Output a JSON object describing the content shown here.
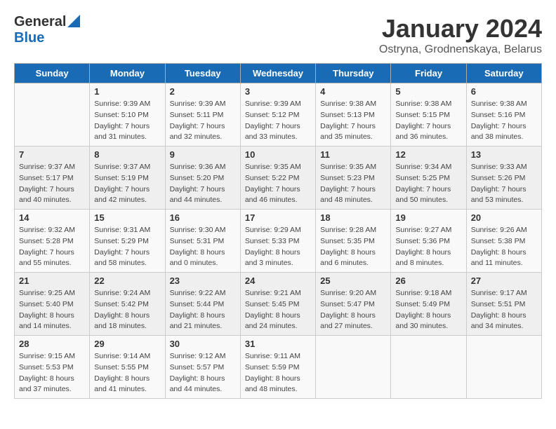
{
  "logo": {
    "general": "General",
    "blue": "Blue"
  },
  "title": "January 2024",
  "subtitle": "Ostryna, Grodnenskaya, Belarus",
  "days_of_week": [
    "Sunday",
    "Monday",
    "Tuesday",
    "Wednesday",
    "Thursday",
    "Friday",
    "Saturday"
  ],
  "weeks": [
    [
      {
        "day": "",
        "info": ""
      },
      {
        "day": "1",
        "info": "Sunrise: 9:39 AM\nSunset: 5:10 PM\nDaylight: 7 hours\nand 31 minutes."
      },
      {
        "day": "2",
        "info": "Sunrise: 9:39 AM\nSunset: 5:11 PM\nDaylight: 7 hours\nand 32 minutes."
      },
      {
        "day": "3",
        "info": "Sunrise: 9:39 AM\nSunset: 5:12 PM\nDaylight: 7 hours\nand 33 minutes."
      },
      {
        "day": "4",
        "info": "Sunrise: 9:38 AM\nSunset: 5:13 PM\nDaylight: 7 hours\nand 35 minutes."
      },
      {
        "day": "5",
        "info": "Sunrise: 9:38 AM\nSunset: 5:15 PM\nDaylight: 7 hours\nand 36 minutes."
      },
      {
        "day": "6",
        "info": "Sunrise: 9:38 AM\nSunset: 5:16 PM\nDaylight: 7 hours\nand 38 minutes."
      }
    ],
    [
      {
        "day": "7",
        "info": "Sunrise: 9:37 AM\nSunset: 5:17 PM\nDaylight: 7 hours\nand 40 minutes."
      },
      {
        "day": "8",
        "info": "Sunrise: 9:37 AM\nSunset: 5:19 PM\nDaylight: 7 hours\nand 42 minutes."
      },
      {
        "day": "9",
        "info": "Sunrise: 9:36 AM\nSunset: 5:20 PM\nDaylight: 7 hours\nand 44 minutes."
      },
      {
        "day": "10",
        "info": "Sunrise: 9:35 AM\nSunset: 5:22 PM\nDaylight: 7 hours\nand 46 minutes."
      },
      {
        "day": "11",
        "info": "Sunrise: 9:35 AM\nSunset: 5:23 PM\nDaylight: 7 hours\nand 48 minutes."
      },
      {
        "day": "12",
        "info": "Sunrise: 9:34 AM\nSunset: 5:25 PM\nDaylight: 7 hours\nand 50 minutes."
      },
      {
        "day": "13",
        "info": "Sunrise: 9:33 AM\nSunset: 5:26 PM\nDaylight: 7 hours\nand 53 minutes."
      }
    ],
    [
      {
        "day": "14",
        "info": "Sunrise: 9:32 AM\nSunset: 5:28 PM\nDaylight: 7 hours\nand 55 minutes."
      },
      {
        "day": "15",
        "info": "Sunrise: 9:31 AM\nSunset: 5:29 PM\nDaylight: 7 hours\nand 58 minutes."
      },
      {
        "day": "16",
        "info": "Sunrise: 9:30 AM\nSunset: 5:31 PM\nDaylight: 8 hours\nand 0 minutes."
      },
      {
        "day": "17",
        "info": "Sunrise: 9:29 AM\nSunset: 5:33 PM\nDaylight: 8 hours\nand 3 minutes."
      },
      {
        "day": "18",
        "info": "Sunrise: 9:28 AM\nSunset: 5:35 PM\nDaylight: 8 hours\nand 6 minutes."
      },
      {
        "day": "19",
        "info": "Sunrise: 9:27 AM\nSunset: 5:36 PM\nDaylight: 8 hours\nand 8 minutes."
      },
      {
        "day": "20",
        "info": "Sunrise: 9:26 AM\nSunset: 5:38 PM\nDaylight: 8 hours\nand 11 minutes."
      }
    ],
    [
      {
        "day": "21",
        "info": "Sunrise: 9:25 AM\nSunset: 5:40 PM\nDaylight: 8 hours\nand 14 minutes."
      },
      {
        "day": "22",
        "info": "Sunrise: 9:24 AM\nSunset: 5:42 PM\nDaylight: 8 hours\nand 18 minutes."
      },
      {
        "day": "23",
        "info": "Sunrise: 9:22 AM\nSunset: 5:44 PM\nDaylight: 8 hours\nand 21 minutes."
      },
      {
        "day": "24",
        "info": "Sunrise: 9:21 AM\nSunset: 5:45 PM\nDaylight: 8 hours\nand 24 minutes."
      },
      {
        "day": "25",
        "info": "Sunrise: 9:20 AM\nSunset: 5:47 PM\nDaylight: 8 hours\nand 27 minutes."
      },
      {
        "day": "26",
        "info": "Sunrise: 9:18 AM\nSunset: 5:49 PM\nDaylight: 8 hours\nand 30 minutes."
      },
      {
        "day": "27",
        "info": "Sunrise: 9:17 AM\nSunset: 5:51 PM\nDaylight: 8 hours\nand 34 minutes."
      }
    ],
    [
      {
        "day": "28",
        "info": "Sunrise: 9:15 AM\nSunset: 5:53 PM\nDaylight: 8 hours\nand 37 minutes."
      },
      {
        "day": "29",
        "info": "Sunrise: 9:14 AM\nSunset: 5:55 PM\nDaylight: 8 hours\nand 41 minutes."
      },
      {
        "day": "30",
        "info": "Sunrise: 9:12 AM\nSunset: 5:57 PM\nDaylight: 8 hours\nand 44 minutes."
      },
      {
        "day": "31",
        "info": "Sunrise: 9:11 AM\nSunset: 5:59 PM\nDaylight: 8 hours\nand 48 minutes."
      },
      {
        "day": "",
        "info": ""
      },
      {
        "day": "",
        "info": ""
      },
      {
        "day": "",
        "info": ""
      }
    ]
  ]
}
